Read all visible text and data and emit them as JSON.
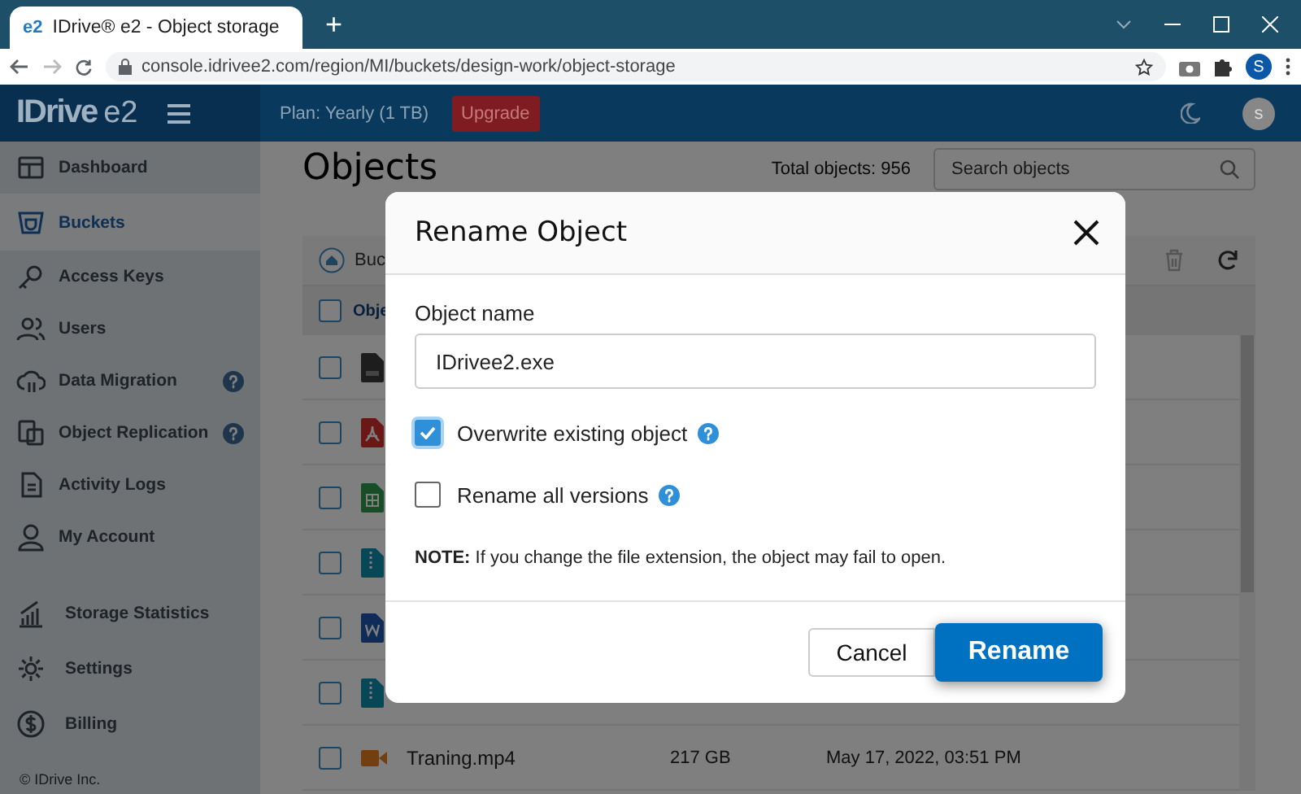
{
  "browser": {
    "favicon": "e2",
    "tab_title": "IDrive® e2 - Object storage",
    "new_tab": "+",
    "url": "console.idrivee2.com/region/MI/buckets/design-work/object-storage",
    "profile": "S"
  },
  "header": {
    "logo": "IDrive",
    "logo_suffix": "e2",
    "plan": "Plan: Yearly (1 TB)",
    "upgrade": "Upgrade",
    "avatar": "s"
  },
  "sidebar": {
    "items": [
      {
        "label": "Dashboard",
        "selected": false,
        "help": false
      },
      {
        "label": "Buckets",
        "selected": true,
        "help": false
      },
      {
        "label": "Access Keys",
        "selected": false,
        "help": false
      },
      {
        "label": "Users",
        "selected": false,
        "help": false
      },
      {
        "label": "Data Migration",
        "selected": false,
        "help": true
      },
      {
        "label": "Object Replication",
        "selected": false,
        "help": true
      },
      {
        "label": "Activity Logs",
        "selected": false,
        "help": false
      },
      {
        "label": "My Account",
        "selected": false,
        "help": false
      },
      {
        "label": "Storage Statistics",
        "selected": false,
        "help": false
      },
      {
        "label": "Settings",
        "selected": false,
        "help": false
      },
      {
        "label": "Billing",
        "selected": false,
        "help": false
      }
    ],
    "footer": "© IDrive Inc."
  },
  "main": {
    "title": "Objects",
    "total": "Total objects: 956",
    "search_placeholder": "Search objects",
    "breadcrumb": "Buc",
    "select_all_checked": false,
    "column_1": "Obje",
    "rows": [
      {
        "kind": "exe",
        "checked": false
      },
      {
        "kind": "pdf",
        "checked": false
      },
      {
        "kind": "sheet",
        "checked": false
      },
      {
        "kind": "zip",
        "checked": false
      },
      {
        "kind": "word",
        "checked": false
      },
      {
        "kind": "zip",
        "checked": false
      },
      {
        "kind": "video",
        "checked": false,
        "name": "Traning.mp4",
        "size": "217 GB",
        "date": "May 17, 2022, 03:51 PM"
      }
    ]
  },
  "dialog": {
    "title": "Rename Object",
    "field_label": "Object name",
    "value": "IDrivee2.exe",
    "options": [
      {
        "label": "Overwrite existing object",
        "checked": true
      },
      {
        "label": "Rename all versions",
        "checked": false
      }
    ],
    "note": "**NOTE:** If you change the file extension, the object may fail to open.",
    "cancel": "Cancel",
    "confirm": "Rename"
  }
}
